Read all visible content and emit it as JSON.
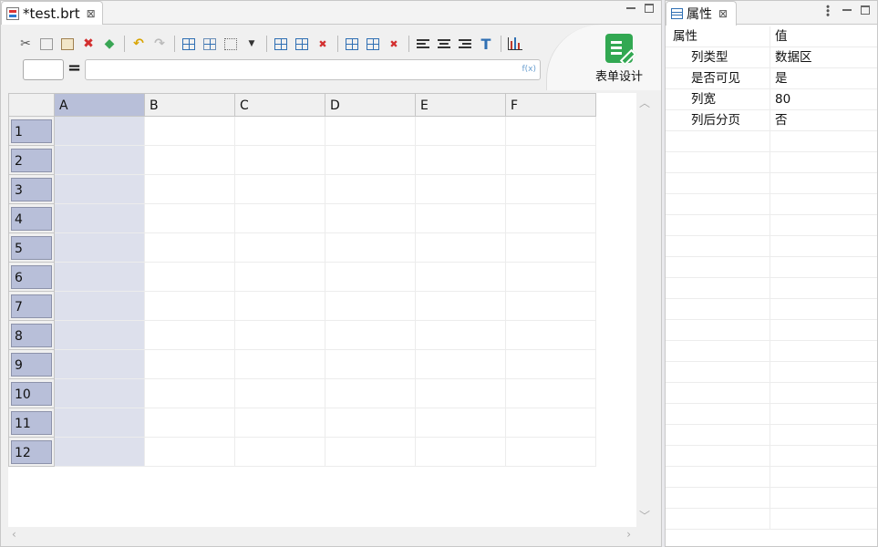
{
  "editor": {
    "tab_title": "*test.brt",
    "tab_close": "⊠",
    "formula_prefix": "=",
    "fx_label": "f(x)",
    "design_button_label": "表单设计",
    "toolbar": [
      {
        "name": "cut-icon",
        "glyph": "✂"
      },
      {
        "name": "copy-icon",
        "glyph": "⎘"
      },
      {
        "name": "paste-icon",
        "glyph": "📋"
      },
      {
        "name": "delete-icon",
        "glyph": "✖"
      },
      {
        "name": "eraser-icon",
        "glyph": "⌫"
      },
      {
        "name": "undo-icon",
        "glyph": "↶"
      },
      {
        "name": "redo-icon",
        "glyph": "↷"
      }
    ],
    "columns": [
      "A",
      "B",
      "C",
      "D",
      "E",
      "F"
    ],
    "rows": [
      "1",
      "2",
      "3",
      "4",
      "5",
      "6",
      "7",
      "8",
      "9",
      "10",
      "11",
      "12"
    ],
    "selected_column": "A"
  },
  "properties": {
    "tab_title": "属性",
    "tab_close": "⊠",
    "header": {
      "name": "属性",
      "value": "值"
    },
    "rows": [
      {
        "name": "列类型",
        "value": "数据区"
      },
      {
        "name": "是否可见",
        "value": "是"
      },
      {
        "name": "列宽",
        "value": "80"
      },
      {
        "name": "列后分页",
        "value": "否"
      }
    ],
    "empty_rows": 19
  }
}
